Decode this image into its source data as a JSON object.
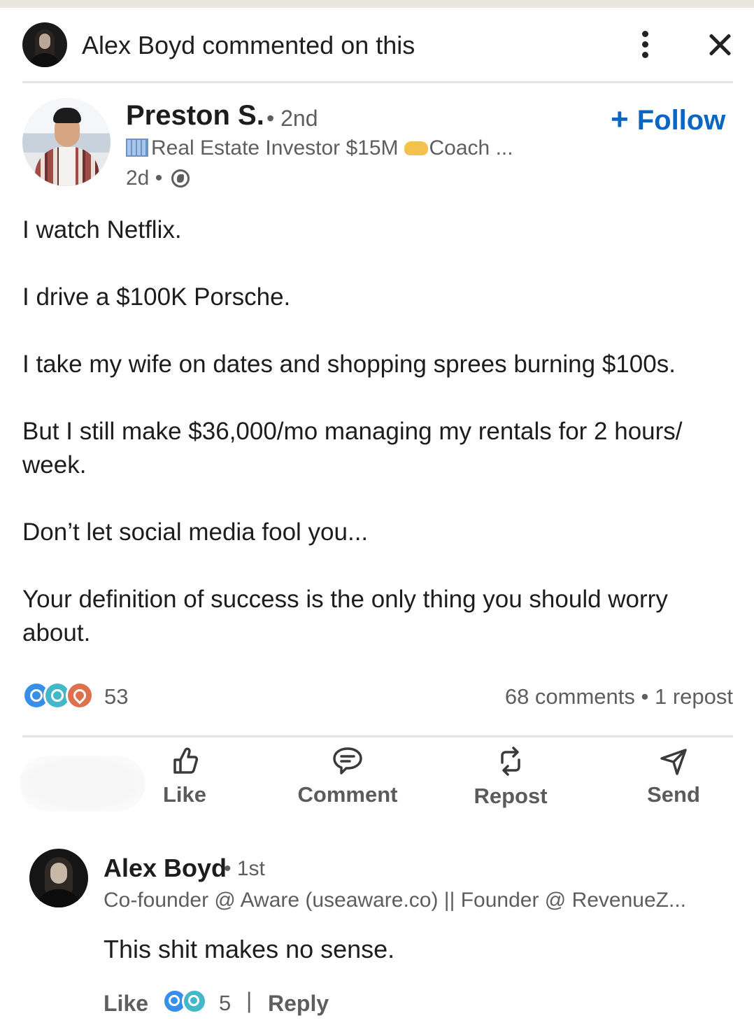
{
  "header": {
    "commenter": "Alex Boyd",
    "action_text": "commented on this"
  },
  "post": {
    "author": {
      "name": "Preston S.",
      "degree": "• 2nd",
      "headline_part1": "Real Estate Investor $15M",
      "headline_part2": "Coach ...",
      "time": "2d •",
      "visibility_icon": "globe-icon"
    },
    "follow_label": "Follow",
    "paragraphs": [
      "I watch Netflix.",
      "I drive a $100K Porsche.",
      "I take my wife on dates and shopping sprees burning $100s.",
      "But I still make $36,000/mo managing my rentals for 2 hours/ week.",
      "Don’t let social media fool you...",
      "Your definition of success is the only thing you should worry about."
    ],
    "reaction_count": "53",
    "comments_reposts": "68 comments • 1 repost"
  },
  "actions": {
    "like": "Like",
    "comment": "Comment",
    "repost": "Repost",
    "send": "Send"
  },
  "comment": {
    "name": "Alex Boyd",
    "degree": "• 1st",
    "headline": "Co-founder @ Aware (useaware.co) || Founder @ RevenueZ...",
    "text": "This shit makes no sense.",
    "like_label": "Like",
    "reaction_count": "5",
    "separator": "|",
    "reply_label": "Reply"
  },
  "colors": {
    "accent": "#0a66c2",
    "like": "#378fe9",
    "funny": "#44b8c9",
    "love": "#df704d"
  }
}
